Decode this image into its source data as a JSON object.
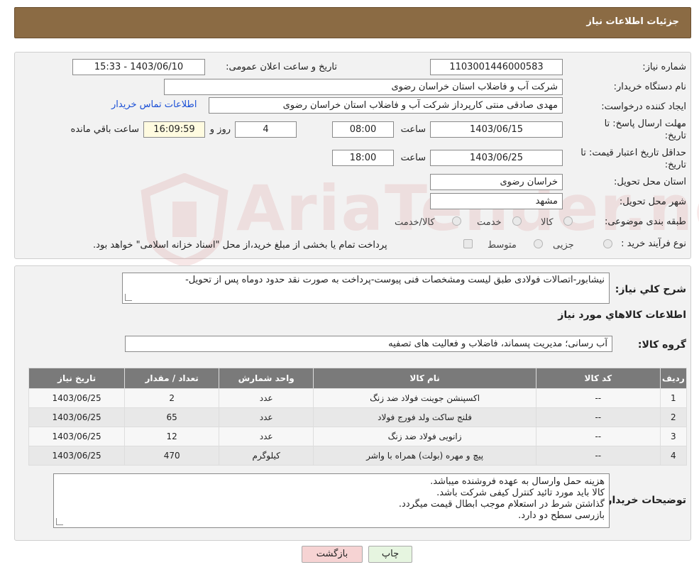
{
  "header": {
    "title": "جزئیات اطلاعات نیاز"
  },
  "form": {
    "need_number_label": "شماره نیاز:",
    "need_number": "1103001446000583",
    "announce_label": "تاریخ و ساعت اعلان عمومی:",
    "announce_value": "1403/06/10 - 15:33",
    "buyer_org_label": "نام دستگاه خریدار:",
    "buyer_org": "شرکت آب و فاضلاب استان خراسان رضوی",
    "creator_label": "ایجاد کننده درخواست:",
    "creator": "مهدی صادقی منتی کارپرداز شرکت آب و فاضلاب استان خراسان رضوی",
    "contact_link": "اطلاعات تماس خریدار",
    "reply_deadline_label": "مهلت ارسال پاسخ: تا تاریخ:",
    "reply_date": "1403/06/15",
    "time_label": "ساعت",
    "reply_time": "08:00",
    "days_value": "4",
    "days_label": "روز و",
    "remaining_time": "16:09:59",
    "remaining_label": "ساعت باقي مانده",
    "price_validity_label": "حداقل تاریخ اعتبار قیمت: تا تاریخ:",
    "price_date": "1403/06/25",
    "price_time": "18:00",
    "province_label": "استان محل تحویل:",
    "province": "خراسان رضوی",
    "city_label": "شهر محل تحویل:",
    "city": "مشهد",
    "category_label": "طبقه بندی موضوعی:",
    "category_options": [
      "کالا",
      "خدمت",
      "کالا/خدمت"
    ],
    "process_label": "نوع فرآیند خرید :",
    "process_options": [
      "جزیی",
      "متوسط"
    ],
    "process_note": "پرداخت تمام یا بخشی از مبلغ خرید،از محل \"اسناد خزانه اسلامی\" خواهد بود."
  },
  "description": {
    "label": "شرح کلي نياز:",
    "text": "نیشابور-اتصالات فولادی طبق لیست ومشخصات فنی پیوست-پرداخت به صورت نقد حدود دوماه پس از تحویل-"
  },
  "goods": {
    "section_title": "اطلاعات کالاهاي مورد نياز",
    "group_label": "گروه کالا:",
    "group_value": "آب رسانی؛ مدیریت پسماند، فاضلاب و فعالیت های تصفیه",
    "columns": [
      "ردیف",
      "کد کالا",
      "نام کالا",
      "واحد شمارش",
      "تعداد / مقدار",
      "تاریخ نیاز"
    ],
    "rows": [
      {
        "idx": "1",
        "code": "--",
        "name": "اکسپنشن جوینت فولاد ضد زنگ",
        "unit": "عدد",
        "qty": "2",
        "date": "1403/06/25"
      },
      {
        "idx": "2",
        "code": "--",
        "name": "فلنج ساکت ولد فورج فولاد",
        "unit": "عدد",
        "qty": "65",
        "date": "1403/06/25"
      },
      {
        "idx": "3",
        "code": "--",
        "name": "زانویی فولاد ضد زنگ",
        "unit": "عدد",
        "qty": "12",
        "date": "1403/06/25"
      },
      {
        "idx": "4",
        "code": "--",
        "name": "پیچ و مهره (بولت) همراه با واشر",
        "unit": "کیلوگرم",
        "qty": "470",
        "date": "1403/06/25"
      }
    ]
  },
  "buyer_notes": {
    "label": "توضیحات خریدار:",
    "lines": [
      "هزینه حمل وارسال به عهده فروشنده میباشد.",
      "کالا باید مورد تائید کنترل کیفی شرکت باشد.",
      "گذاشتن شرط در استعلام موجب ابطال قیمت میگردد.",
      "بازرسی سطح دو دارد."
    ]
  },
  "buttons": {
    "print": "چاپ",
    "back": "بازگشت"
  },
  "watermark": {
    "text": "AriaTender.neT"
  },
  "colors": {
    "header": "#8b6b44",
    "table_header": "#7a7a7a",
    "link": "#1a4fd6",
    "back_button": "#f6d3d3",
    "print_button": "#e6f5e0"
  }
}
